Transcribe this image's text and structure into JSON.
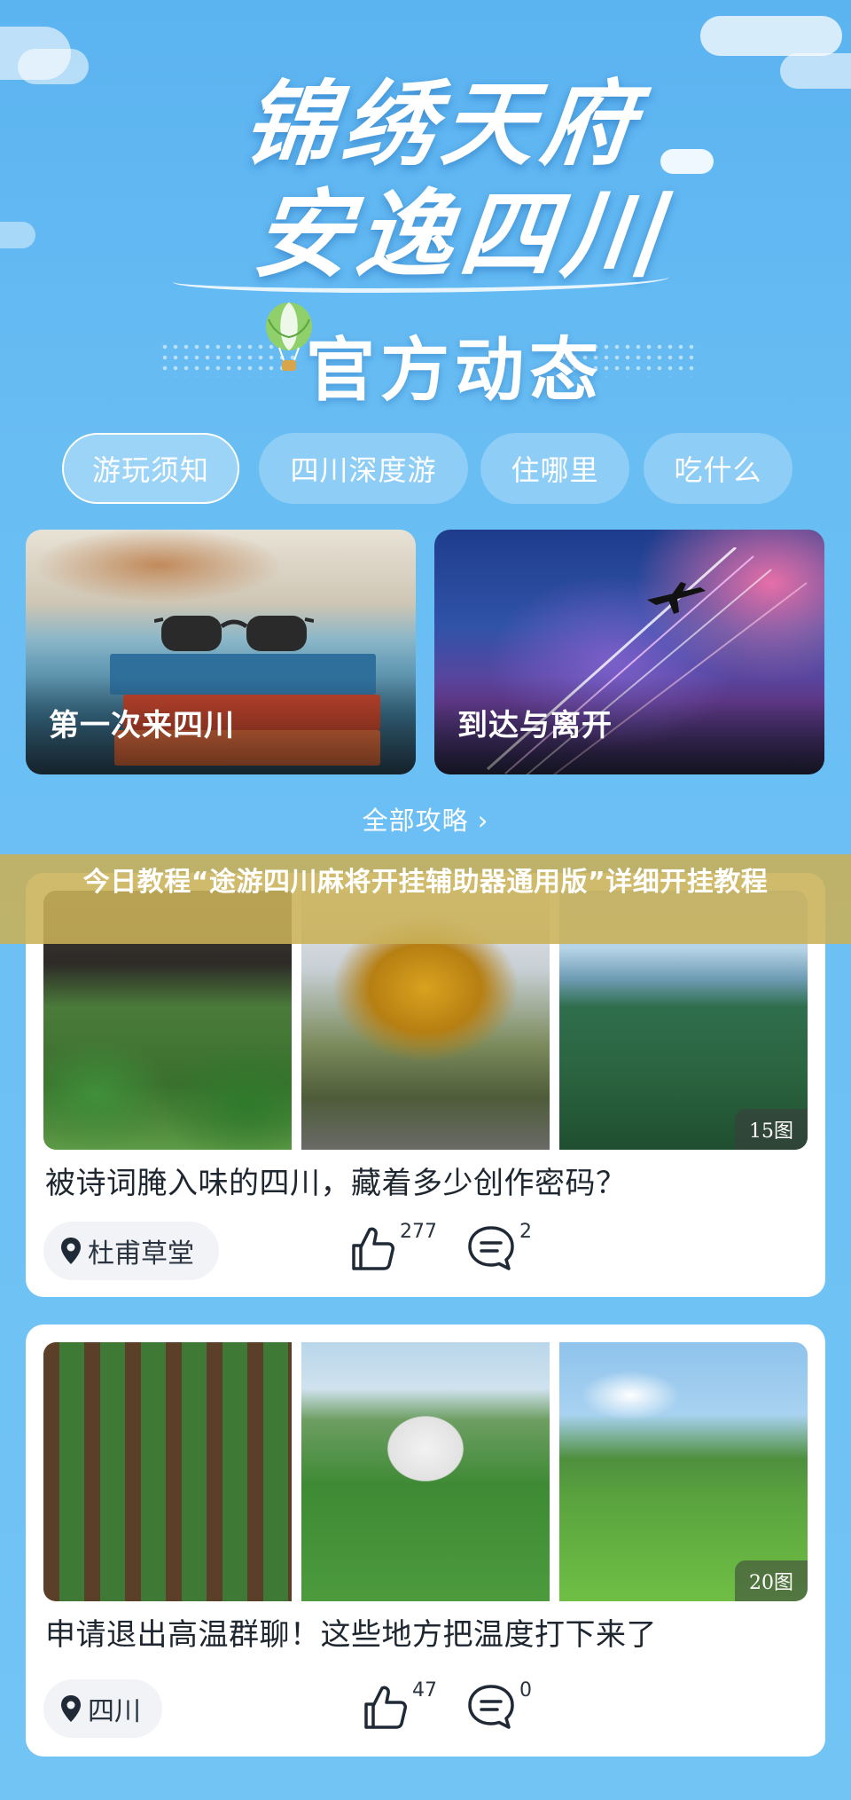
{
  "hero": {
    "title_line1": "锦绣天府",
    "title_line2": "安逸四川",
    "subtitle": "官方动态"
  },
  "tabs": [
    {
      "label": "游玩须知",
      "active": true
    },
    {
      "label": "四川深度游",
      "active": false
    },
    {
      "label": "住哪里",
      "active": false
    },
    {
      "label": "吃什么",
      "active": false
    }
  ],
  "features": [
    {
      "label": "第一次来四川",
      "image": "beach-books-glasses"
    },
    {
      "label": "到达与离开",
      "image": "airplane-sky"
    }
  ],
  "all_guides": "全部攻略 ›",
  "banner": {
    "text": "今日教程“途游四川麻将开挂辅助器通用版”详细开挂教程"
  },
  "posts": [
    {
      "photo_count": "15图",
      "title": "被诗词腌入味的四川，藏着多少创作密码？",
      "location": "杜甫草堂",
      "likes": "277",
      "comments": "2"
    },
    {
      "photo_count": "20图",
      "title": "申请退出高温群聊！这些地方把温度打下来了",
      "location": "四川",
      "likes": "47",
      "comments": "0"
    }
  ],
  "colors": {
    "background": "#68bdf3",
    "banner": "#c9b058",
    "card": "#ffffff"
  }
}
